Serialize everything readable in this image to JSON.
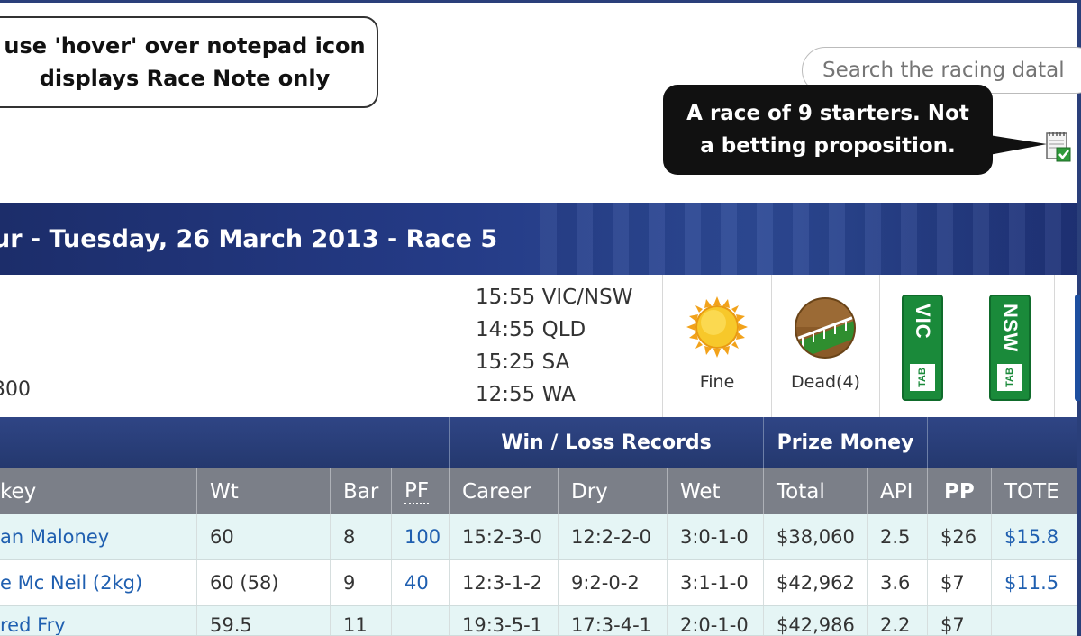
{
  "callout": {
    "line1": "use 'hover' over notepad icon",
    "line2": "displays Race Note only"
  },
  "search": {
    "placeholder": "Search the racing datal"
  },
  "tooltip": {
    "line1": "A race of 9 starters. Not",
    "line2": "a betting proposition."
  },
  "race": {
    "title": "ur - Tuesday, 26 March 2013 - Race 5",
    "distance": "300",
    "times": [
      "15:55 VIC/NSW",
      "14:55 QLD",
      "15:25 SA",
      "12:55 WA"
    ],
    "weather": "Fine",
    "track": "Dead(4)",
    "tab_vic": "VIC",
    "tab_nsw": "NSW",
    "tab_small": "TAB"
  },
  "group_headers": {
    "win_loss": "Win / Loss Records",
    "prize": "Prize Money"
  },
  "columns": {
    "jockey": "key",
    "wt": "Wt",
    "bar": "Bar",
    "pf": "PF",
    "career": "Career",
    "dry": "Dry",
    "wet": "Wet",
    "total": "Total",
    "api": "API",
    "pp": "PP",
    "tote": "TOTE"
  },
  "rows": [
    {
      "jockey": "an Maloney",
      "wt": "60",
      "bar": "8",
      "pf": "100",
      "career": "15:2-3-0",
      "dry": "12:2-2-0",
      "wet": "3:0-1-0",
      "total": "$38,060",
      "api": "2.5",
      "pp": "$26",
      "tote": "$15.8"
    },
    {
      "jockey": "e Mc Neil (2kg)",
      "wt": "60 (58)",
      "bar": "9",
      "pf": "40",
      "career": "12:3-1-2",
      "dry": "9:2-0-2",
      "wet": "3:1-1-0",
      "total": "$42,962",
      "api": "3.6",
      "pp": "$7",
      "tote": "$11.5"
    },
    {
      "jockey": "red Fry",
      "wt": "59.5",
      "bar": "11",
      "pf": "",
      "career": "19:3-5-1",
      "dry": "17:3-4-1",
      "wet": "2:0-1-0",
      "total": "$42,986",
      "api": "2.2",
      "pp": "$7",
      "tote": ""
    }
  ],
  "colors": {
    "title_bar": "#243a85",
    "header_grey": "#7b7f88",
    "row_alt": "#e5f5f5",
    "link": "#1f5fb0",
    "tab_green": "#1a8a3a"
  },
  "icons": {
    "notepad": "notepad-check-icon",
    "weather": "sun-icon",
    "track": "track-icon"
  }
}
